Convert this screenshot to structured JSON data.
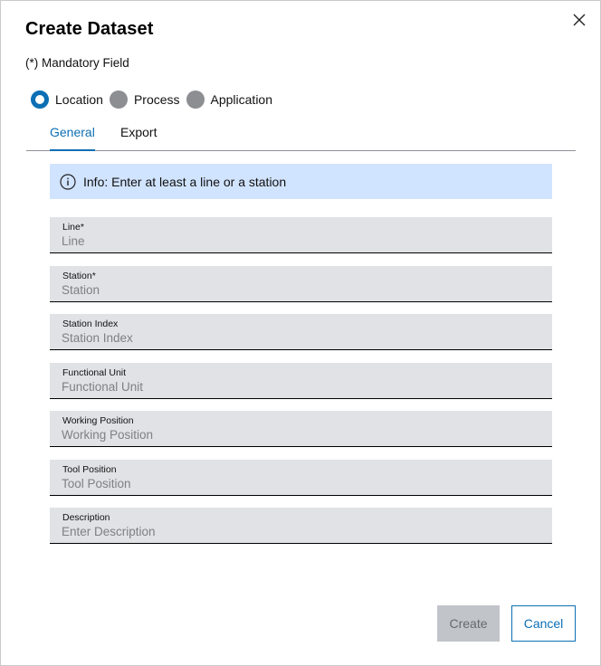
{
  "dialog": {
    "title": "Create Dataset",
    "mandatory_note": "(*) Mandatory Field",
    "close_icon": "close-icon"
  },
  "steps": [
    {
      "label": "Location",
      "state": "active"
    },
    {
      "label": "Process",
      "state": "inactive"
    },
    {
      "label": "Application",
      "state": "inactive"
    }
  ],
  "tabs": [
    {
      "label": "General",
      "active": true
    },
    {
      "label": "Export",
      "active": false
    }
  ],
  "info": {
    "icon": "info-icon",
    "text": "Info: Enter at least a line or a station"
  },
  "fields": [
    {
      "label": "Line*",
      "placeholder": "Line",
      "value": ""
    },
    {
      "label": "Station*",
      "placeholder": "Station",
      "value": ""
    },
    {
      "label": "Station Index",
      "placeholder": "Station Index",
      "value": ""
    },
    {
      "label": "Functional Unit",
      "placeholder": "Functional Unit",
      "value": ""
    },
    {
      "label": "Working Position",
      "placeholder": "Working Position",
      "value": ""
    },
    {
      "label": "Tool Position",
      "placeholder": "Tool Position",
      "value": ""
    },
    {
      "label": "Description",
      "placeholder": "Enter Description",
      "value": ""
    }
  ],
  "actions": {
    "create_label": "Create",
    "cancel_label": "Cancel"
  },
  "colors": {
    "accent": "#0c6fb4",
    "info_background": "#d1e4ff",
    "field_background": "#e0e2e5",
    "disabled_button": "#c1c5c9"
  }
}
